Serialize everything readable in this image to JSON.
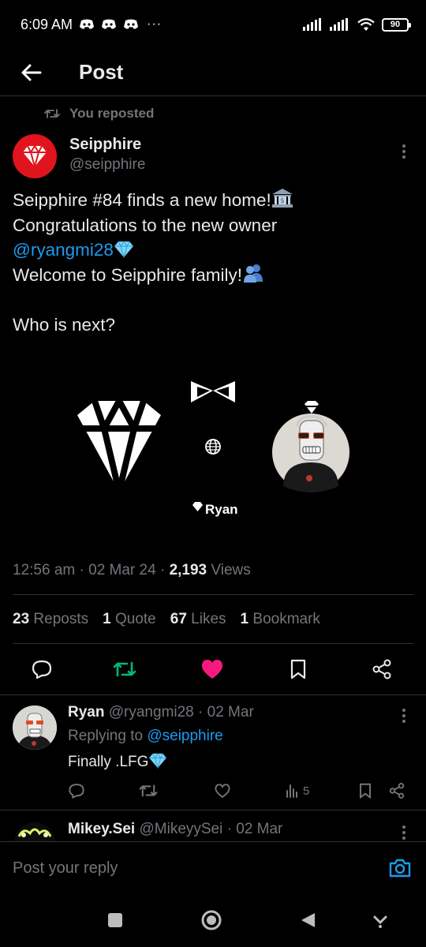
{
  "status_bar": {
    "time": "6:09 AM",
    "overflow": "···",
    "battery": "90"
  },
  "header": {
    "title": "Post",
    "back_icon": "arrow-left-icon"
  },
  "repost": {
    "label": "You reposted"
  },
  "post": {
    "author_name": "Seipphire",
    "author_handle": "@seipphire",
    "text_line1": "Seipphire #84 finds a new home!",
    "text_line2": "Congratulations to the new owner",
    "text_mention": "@ryangmi28",
    "text_line4": "Welcome to Seipphire family!",
    "text_line5": "Who is next?",
    "media_caption": "Ryan",
    "time": "12:56 am",
    "date": "02 Mar 24",
    "views_count": "2,193",
    "views_label": "Views",
    "reposts_count": "23",
    "reposts_label": "Reposts",
    "quotes_count": "1",
    "quotes_label": "Quote",
    "likes_count": "67",
    "likes_label": "Likes",
    "bookmarks_count": "1",
    "bookmarks_label": "Bookmark",
    "accent": "#1d9bf0",
    "repost_active_color": "#00ba7c",
    "like_active_color": "#f91880"
  },
  "reply": {
    "name": "Ryan",
    "handle": "@ryangmi28",
    "date": "· 02 Mar",
    "replying_prefix": "Replying to",
    "replying_handle": "@seipphire",
    "text": "Finally .LFG",
    "views_count": "5"
  },
  "next_reply": {
    "name": "Mikey.Sei",
    "handle": "@MikeyySei",
    "date": "· 02 Mar"
  },
  "composer": {
    "placeholder": "Post your reply"
  }
}
